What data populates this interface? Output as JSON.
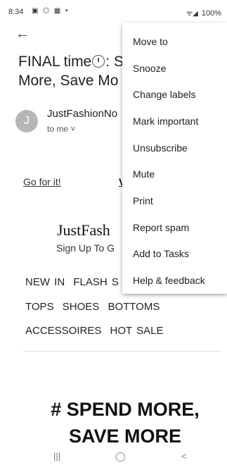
{
  "status_bar": {
    "time": "8:34",
    "left_icons": "▣ ⬡ ▦ •",
    "signal": "ᯤ◢",
    "battery": "100%"
  },
  "email": {
    "subject_line1_before": "FINAL time",
    "subject_line1_after": ": S",
    "subject_line2": "More, Save Mo",
    "sender_initial": "J",
    "sender_name": "JustFashionNo",
    "recipient": "to me ˅"
  },
  "email_body": {
    "go_for_it": "Go for it!",
    "view_link": "V",
    "brand": "JustFash",
    "signup": "Sign Up To G",
    "categories_row1": [
      "NEW IN",
      "FLASH S"
    ],
    "categories_row2": [
      "TOPS",
      "SHOES",
      "BOTTOMS"
    ],
    "categories_row3": [
      "ACCESSOIRES",
      "HOT SALE"
    ],
    "headline_line1": "# SPEND MORE,",
    "headline_line2": "SAVE MORE"
  },
  "menu": {
    "items": [
      "Move to",
      "Snooze",
      "Change labels",
      "Mark important",
      "Unsubscribe",
      "Mute",
      "Print",
      "Report spam",
      "Add to Tasks",
      "Help & feedback"
    ]
  },
  "nav": {
    "recents": "|||",
    "home": "◯",
    "back": "<"
  }
}
